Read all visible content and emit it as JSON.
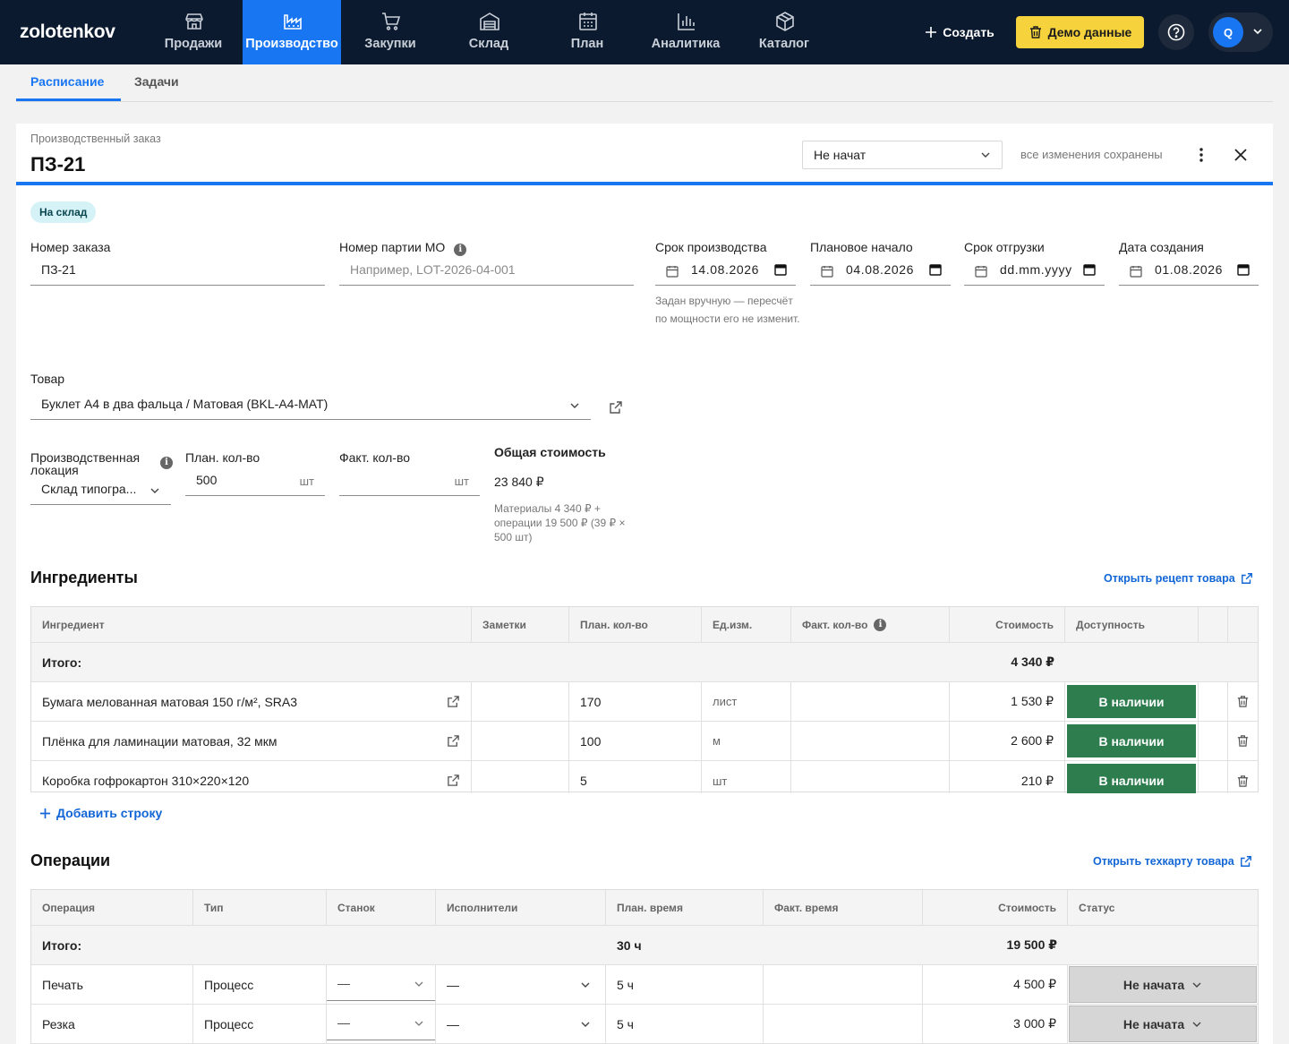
{
  "app": {
    "logo": "zolotenkov"
  },
  "nav": [
    {
      "label": "Продажи",
      "icon": "store-icon"
    },
    {
      "label": "Производство",
      "icon": "factory-icon",
      "active": true
    },
    {
      "label": "Закупки",
      "icon": "cart-icon"
    },
    {
      "label": "Склад",
      "icon": "warehouse-icon"
    },
    {
      "label": "План",
      "icon": "calendar-grid-icon"
    },
    {
      "label": "Аналитика",
      "icon": "bar-chart-icon"
    },
    {
      "label": "Каталог",
      "icon": "box-icon"
    }
  ],
  "topbar": {
    "create_label": "Создать",
    "demo_label": "Демо данные",
    "avatar_letter": "Q"
  },
  "subtabs": [
    {
      "label": "Расписание",
      "active": true
    },
    {
      "label": "Задачи"
    }
  ],
  "order": {
    "kind_label": "Производственный заказ",
    "title": "ПЗ-21",
    "status_value": "Не начат",
    "saved_text": "все изменения сохранены",
    "badge": "На склад",
    "fields": {
      "order_number_label": "Номер заказа",
      "order_number_value": "ПЗ-21",
      "batch_label": "Номер партии МО",
      "batch_placeholder": "Например, LOT-2026-04-001",
      "due_label": "Срок производства",
      "due_value": "14.08.2026",
      "due_hint": "Задан вручную — пересчёт по мощности его не изменит.",
      "plan_start_label": "Плановое начало",
      "plan_start_value": "04.08.2026",
      "ship_label": "Срок отгрузки",
      "ship_value": "dd.mm.yyyy",
      "created_label": "Дата создания",
      "created_value": "01.08.2026",
      "product_label": "Товар",
      "product_value": "Буклет А4 в два фальца / Матовая (BKL-A4-MAT)",
      "location_label": "Производственная локация",
      "location_value": "Склад типогра...",
      "plan_qty_label": "План. кол-во",
      "plan_qty_value": "500",
      "qty_unit": "шт",
      "fact_qty_label": "Факт. кол-во",
      "total_cost_label": "Общая стоимость",
      "total_cost_value": "23 840 ₽",
      "total_cost_hint": "Материалы 4 340 ₽ + операции 19 500 ₽ (39 ₽ × 500 шт)"
    }
  },
  "ingredients": {
    "title": "Ингредиенты",
    "link": "Открыть рецепт товара",
    "columns": [
      "Ингредиент",
      "Заметки",
      "План. кол-во",
      "Ед.изм.",
      "Факт. кол-во",
      "Стоимость",
      "Доступность"
    ],
    "total_label": "Итого:",
    "total_value": "4 340 ₽",
    "rows": [
      {
        "name": "Бумага мелованная матовая 150 г/м², SRA3",
        "qty": "170",
        "unit": "лист",
        "cost": "1 530 ₽",
        "availability": "В наличии"
      },
      {
        "name": "Плёнка для ламинации матовая, 32 мкм",
        "qty": "100",
        "unit": "м",
        "cost": "2 600 ₽",
        "availability": "В наличии"
      },
      {
        "name": "Коробка гофрокартон 310×220×120",
        "qty": "5",
        "unit": "шт",
        "cost": "210 ₽",
        "availability": "В наличии"
      }
    ],
    "add_row": "Добавить строку"
  },
  "operations": {
    "title": "Операции",
    "link": "Открыть техкарту товара",
    "columns": [
      "Операция",
      "Тип",
      "Станок",
      "Исполнители",
      "План. время",
      "Факт. время",
      "Стоимость",
      "Статус"
    ],
    "total_label": "Итого:",
    "total_time": "30 ч",
    "total_cost": "19 500 ₽",
    "rows": [
      {
        "name": "Печать",
        "type": "Процесс",
        "machine": "—",
        "workers": "—",
        "time": "5 ч",
        "cost": "4 500 ₽",
        "status": "Не начата"
      },
      {
        "name": "Резка",
        "type": "Процесс",
        "machine": "—",
        "workers": "—",
        "time": "5 ч",
        "cost": "3 000 ₽",
        "status": "Не начата"
      }
    ]
  },
  "colors": {
    "topbar": "#0b1a2e",
    "accent": "#1976f2",
    "demo": "#f6d23c",
    "in_stock": "#2e7d4f",
    "badge": "#d5f3f6"
  }
}
